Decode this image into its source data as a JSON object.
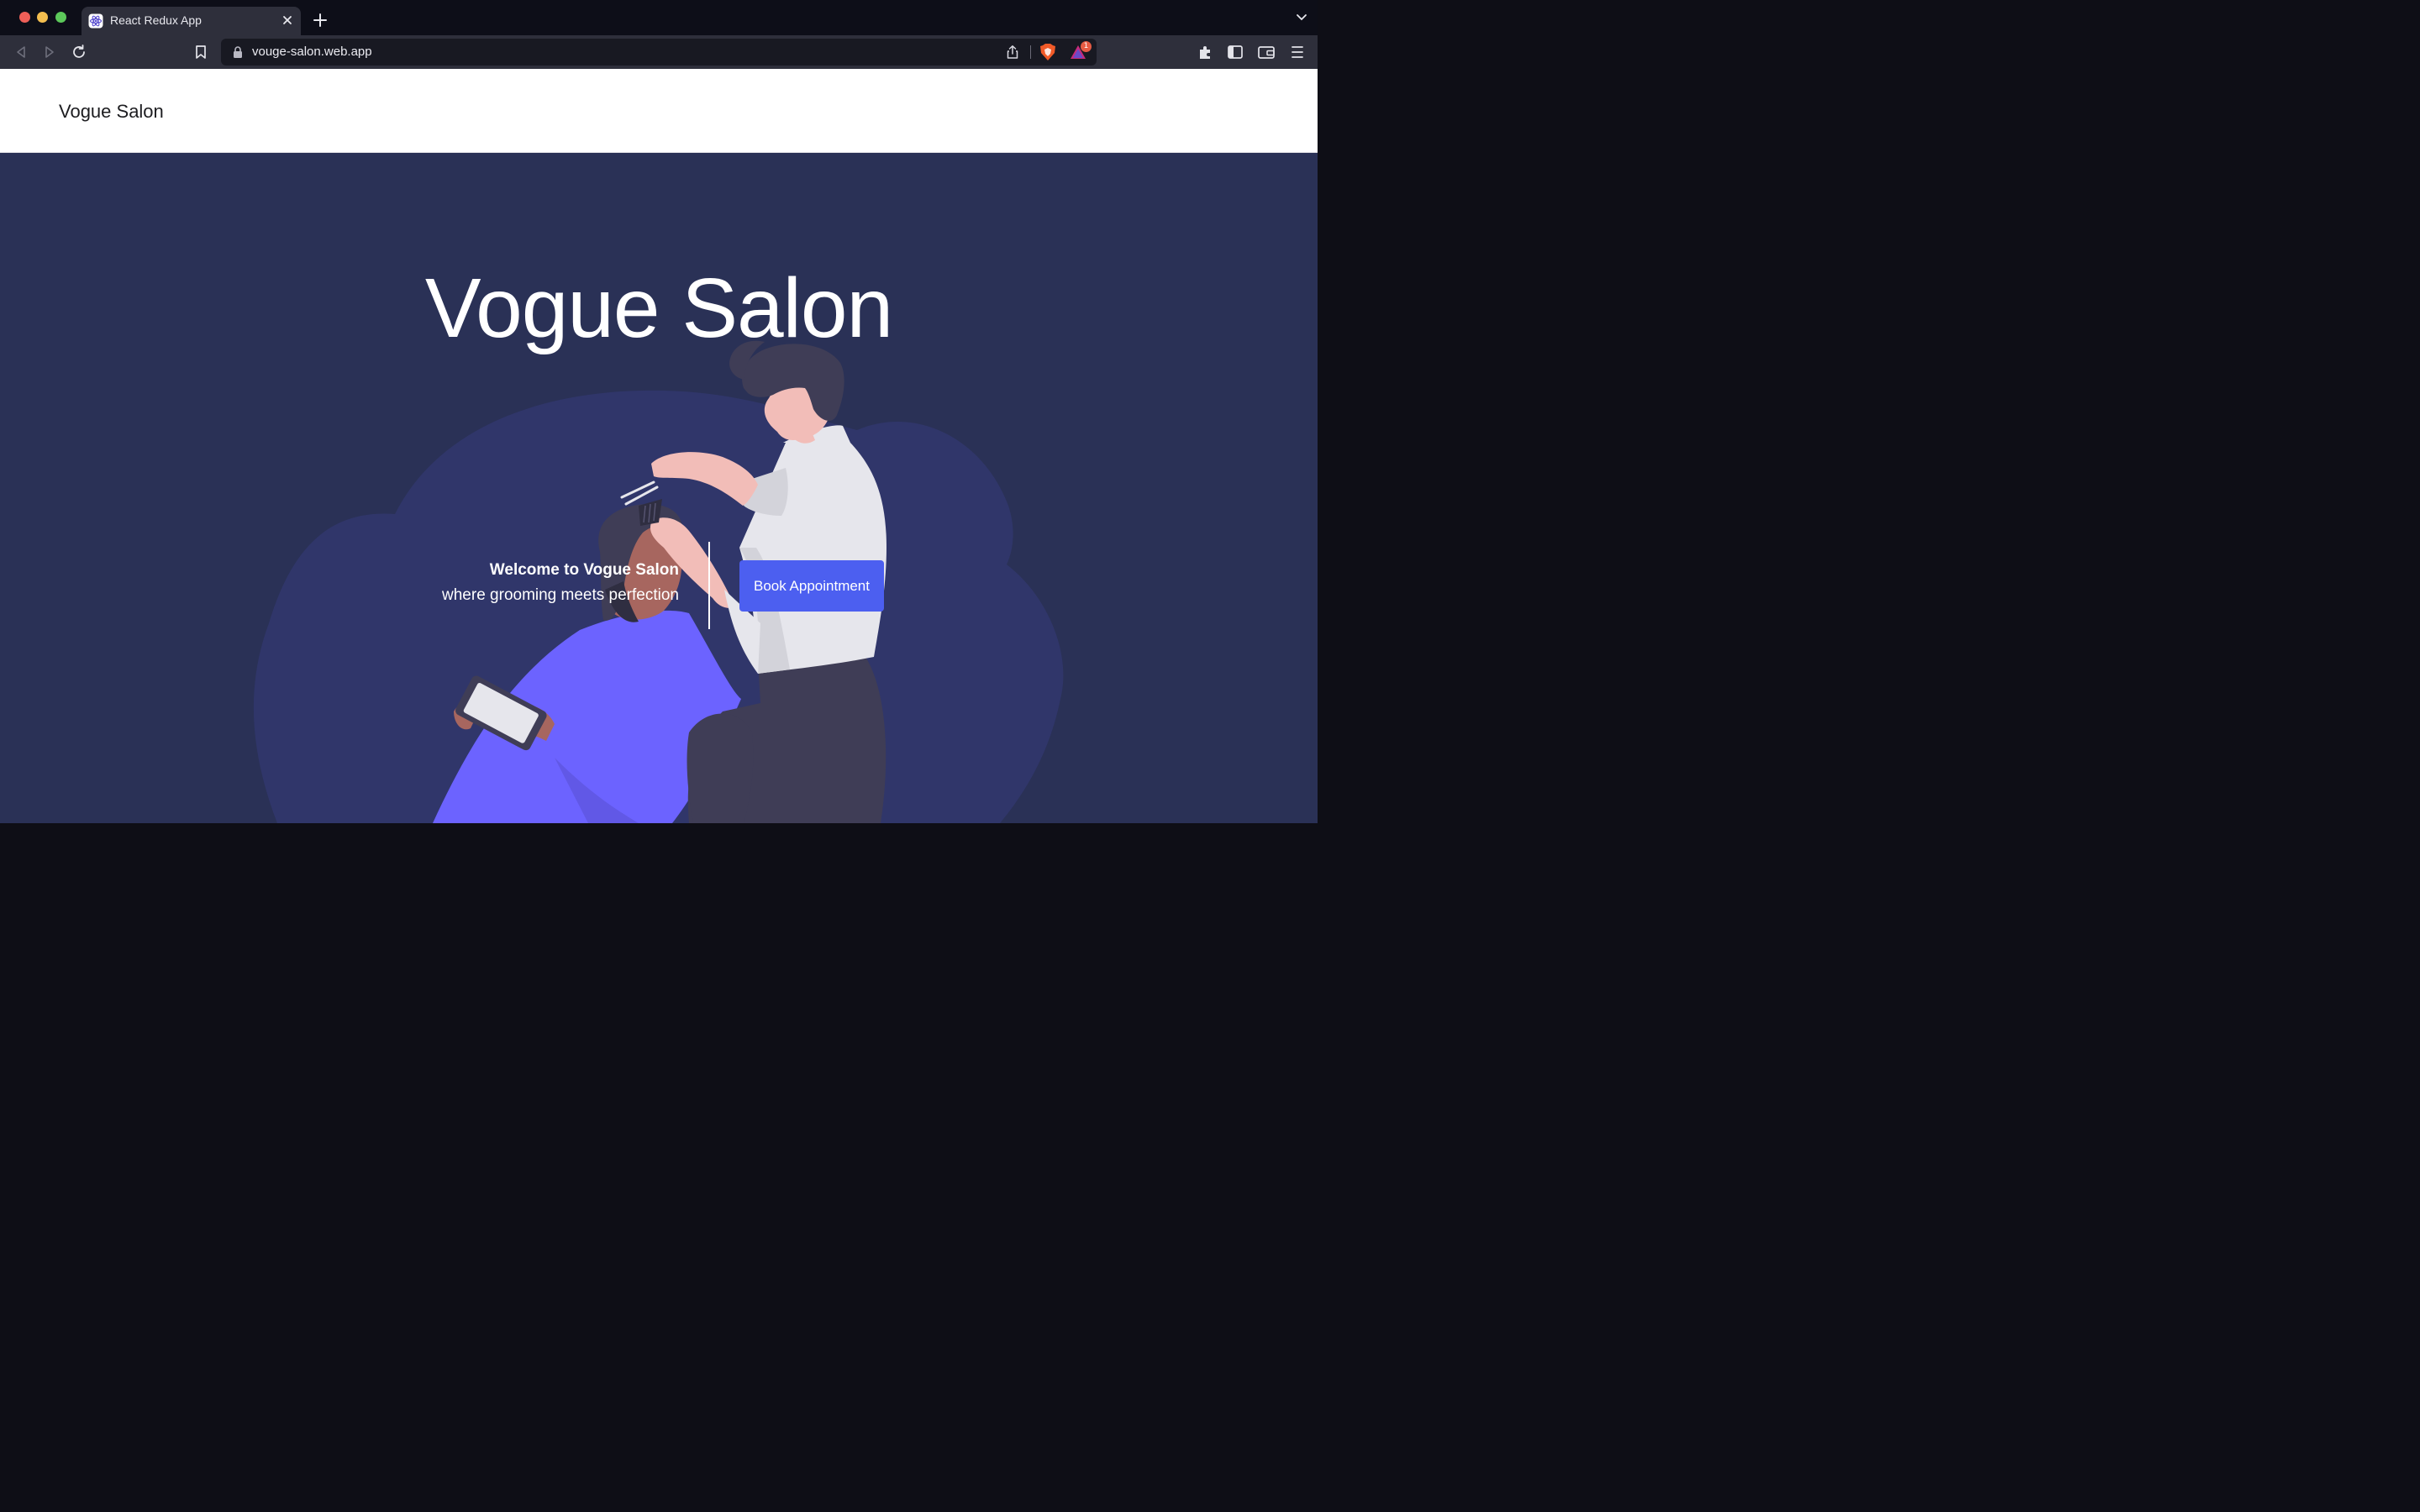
{
  "browser": {
    "tab": {
      "title": "React Redux App",
      "favicon": "react-icon"
    },
    "url": "vouge-salon.web.app",
    "rewards_badge": "1",
    "icons": [
      "back-icon",
      "forward-icon",
      "reload-icon",
      "bookmark-icon",
      "lock-icon",
      "share-icon",
      "brave-shield-icon",
      "brave-rewards-icon",
      "extensions-icon",
      "sidebar-icon",
      "wallet-icon",
      "menu-icon",
      "close-icon",
      "new-tab-icon",
      "chevron-down-icon"
    ]
  },
  "header": {
    "brand": "Vogue Salon"
  },
  "hero": {
    "title": "Vogue Salon",
    "welcome": "Welcome to Vogue Salon",
    "tagline": "where grooming meets perfection",
    "cta_label": "Book Appointment"
  },
  "colors": {
    "hero_bg": "#2a3156",
    "blob": "#30366a",
    "button": "#4c5ff0",
    "cape": "#6c63ff",
    "chrome_dark": "#0d0e18",
    "chrome_toolbar": "#2e2f3b"
  }
}
